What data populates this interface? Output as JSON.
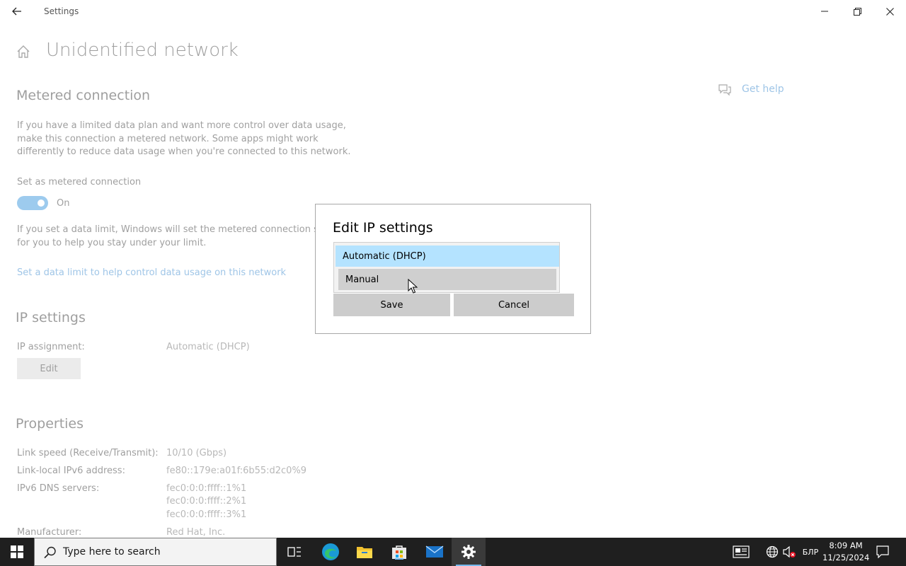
{
  "window": {
    "title": "Settings",
    "back_icon": "arrow-left-icon",
    "minimize_icon": "minimize-icon",
    "restore_icon": "restore-icon",
    "close_icon": "close-icon"
  },
  "page": {
    "title": "Unidentified network",
    "home_icon": "home-icon"
  },
  "help": {
    "label": "Get help",
    "icon": "chat-help-icon"
  },
  "metered": {
    "heading": "Metered connection",
    "description": [
      "If you have a limited data plan and want more control over data usage,",
      "make this connection a metered network. Some apps might work",
      "differently to reduce data usage when you're connected to this network."
    ],
    "toggle_label": "Set as metered connection",
    "toggle_state": "On",
    "data_limit_text": [
      "If you set a data limit, Windows will set the metered connection setti",
      "for you to help you stay under your limit."
    ],
    "data_limit_link": "Set a data limit to help control data usage on this network"
  },
  "ip_settings": {
    "heading": "IP settings",
    "assignment_label": "IP assignment:",
    "assignment_value": "Automatic (DHCP)",
    "edit_label": "Edit"
  },
  "properties": {
    "heading": "Properties",
    "rows": [
      {
        "label": "Link speed (Receive/Transmit):",
        "values": [
          "10/10 (Gbps)"
        ]
      },
      {
        "label": "Link-local IPv6 address:",
        "values": [
          "fe80::179e:a01f:6b55:d2c0%9"
        ]
      },
      {
        "label": "IPv6 DNS servers:",
        "values": [
          "fec0:0:0:ffff::1%1",
          "fec0:0:0:ffff::2%1",
          "fec0:0:0:ffff::3%1"
        ]
      },
      {
        "label": "Manufacturer:",
        "values": [
          "Red Hat, Inc."
        ]
      }
    ]
  },
  "dialog": {
    "title": "Edit IP settings",
    "options": [
      "Automatic (DHCP)",
      "Manual"
    ],
    "selected": "Automatic (DHCP)",
    "hovered": "Manual",
    "save_label": "Save",
    "cancel_label": "Cancel"
  },
  "taskbar": {
    "search_placeholder": "Type here to search",
    "apps": [
      "task-view-icon",
      "edge-icon",
      "file-explorer-icon",
      "store-icon",
      "mail-icon",
      "settings-icon"
    ],
    "active_app": "settings-icon",
    "keyboard_layout": "БЛР",
    "time": "8:09 AM",
    "date": "11/25/2024"
  },
  "colors": {
    "accent": "#0078d4",
    "link": "#0067c0",
    "selected_option": "#b4e3ff",
    "taskbar": "#1f1f1f"
  }
}
